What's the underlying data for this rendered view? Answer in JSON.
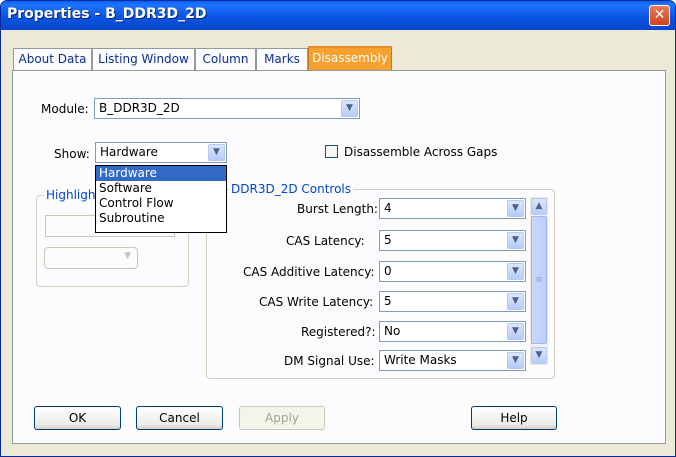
{
  "window": {
    "title": "Properties - B_DDR3D_2D",
    "close_glyph": "✕"
  },
  "tabs": [
    {
      "label": "About Data"
    },
    {
      "label": "Listing Window"
    },
    {
      "label": "Column"
    },
    {
      "label": "Marks"
    },
    {
      "label": "Disassembly",
      "selected": true
    }
  ],
  "module": {
    "label": "Module:",
    "value": "B_DDR3D_2D"
  },
  "show": {
    "label": "Show:",
    "value": "Hardware",
    "options": [
      "Hardware",
      "Software",
      "Control Flow",
      "Subroutine"
    ],
    "selected_option": "Hardware"
  },
  "disassemble_gaps": {
    "label": "Disassemble Across Gaps",
    "checked": false
  },
  "highlight_group": {
    "label": "Highlight"
  },
  "controls_group": {
    "label": "DDR3D_2D Controls",
    "rows": [
      {
        "label": "Burst Length:",
        "value": "4"
      },
      {
        "label": "CAS Latency:",
        "value": "5"
      },
      {
        "label": "CAS Additive Latency:",
        "value": "0"
      },
      {
        "label": "CAS Write Latency:",
        "value": "5"
      },
      {
        "label": "Registered?:",
        "value": "No"
      },
      {
        "label": "DM Signal Use:",
        "value": "Write Masks"
      }
    ]
  },
  "buttons": {
    "ok": "OK",
    "cancel": "Cancel",
    "apply": "Apply",
    "help": "Help"
  },
  "icons": {
    "dropdown": "chevron-down-icon",
    "scroll_up": "chevron-up-icon",
    "scroll_down": "chevron-down-icon"
  },
  "colors": {
    "titlebar": "#0a55e3",
    "selected_tab": "#f6a030",
    "group_label": "#0046d5",
    "list_selection": "#316ac5"
  }
}
